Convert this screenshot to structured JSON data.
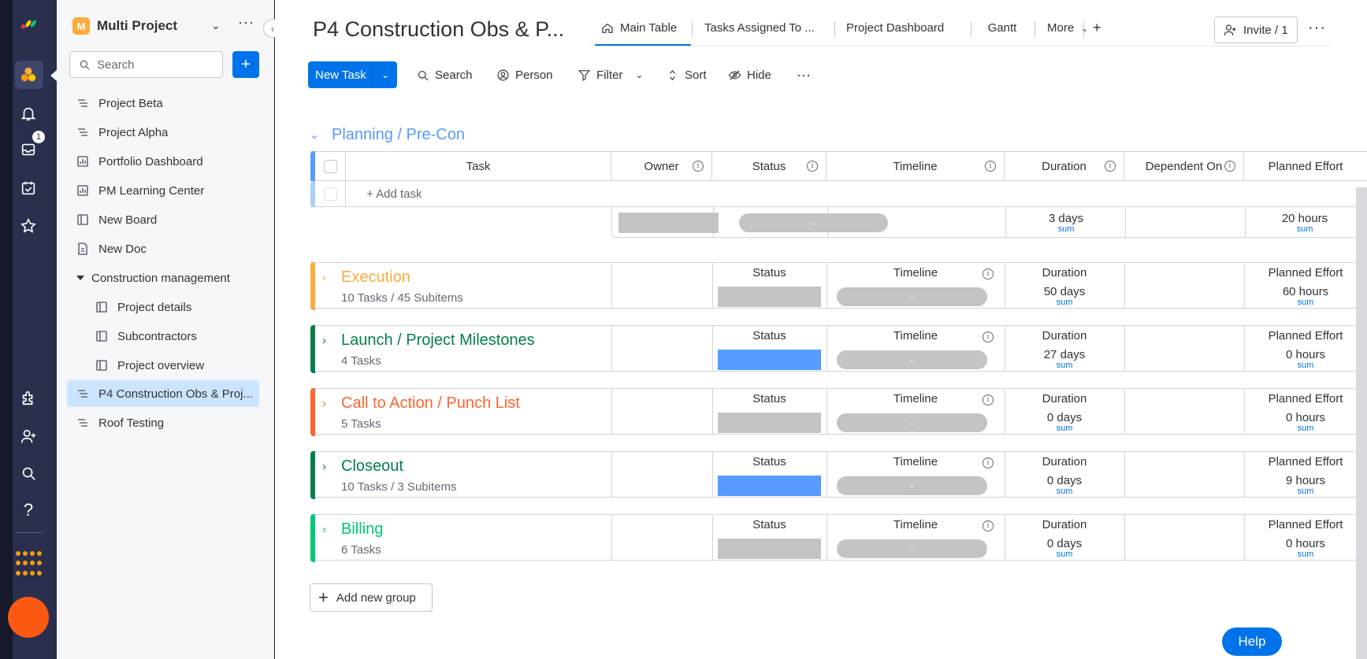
{
  "rail": {
    "notification_count": "1",
    "colors": {
      "bg": "#292f4c",
      "active": "#40466a",
      "apps": "#f59b12",
      "avatar": "#fc5a12"
    }
  },
  "sidebar": {
    "workspace_initial": "M",
    "workspace_name": "Multi Project",
    "search_placeholder": "Search",
    "add_label": "+",
    "items": [
      {
        "label": "Project Beta",
        "icon": "board-icon"
      },
      {
        "label": "Project Alpha",
        "icon": "board-icon"
      },
      {
        "label": "Portfolio Dashboard",
        "icon": "dashboard-icon"
      },
      {
        "label": "PM Learning Center",
        "icon": "dashboard-icon"
      },
      {
        "label": "New Board",
        "icon": "table-icon"
      },
      {
        "label": "New Doc",
        "icon": "doc-icon"
      }
    ],
    "folder": {
      "label": "Construction management",
      "items": [
        {
          "label": "Project details"
        },
        {
          "label": "Subcontractors"
        },
        {
          "label": "Project overview"
        }
      ]
    },
    "selected_item": "P4 Construction Obs & Proj...",
    "last_item": "Roof Testing"
  },
  "header": {
    "title": "P4 Construction Obs & P...",
    "tabs": [
      {
        "label": "Main Table",
        "active": true
      },
      {
        "label": "Tasks Assigned To ..."
      },
      {
        "label": "Project Dashboard"
      },
      {
        "label": "Gantt"
      },
      {
        "label": "More"
      },
      {
        "label": "+"
      }
    ],
    "invite_label": "Invite / 1"
  },
  "toolbar": {
    "new_task": "New Task",
    "search": "Search",
    "person": "Person",
    "filter": "Filter",
    "sort": "Sort",
    "hide": "Hide"
  },
  "expanded_group": {
    "title": "Planning / Pre-Con",
    "color": "#579bfc",
    "columns": {
      "task": "Task",
      "owner": "Owner",
      "status": "Status",
      "timeline": "Timeline",
      "duration": "Duration",
      "dependent_on": "Dependent On",
      "planned_effort": "Planned Effort"
    },
    "add_task": "+ Add task",
    "summary": {
      "timeline": "-",
      "duration": "3 days",
      "duration_label": "sum",
      "effort": "20 hours",
      "effort_label": "sum"
    }
  },
  "groups": [
    {
      "title": "Execution",
      "subtitle": "10 Tasks / 45 Subitems",
      "color": "#fdab3d",
      "status_col": "Status",
      "timeline_col": "Timeline",
      "duration_col": "Duration",
      "effort_col": "Planned Effort",
      "status_fill": "grey",
      "timeline": "-",
      "duration": "50 days",
      "duration_label": "sum",
      "effort": "60 hours",
      "effort_label": "sum"
    },
    {
      "title": "Launch / Project Milestones",
      "subtitle": "4 Tasks",
      "color": "#037f4c",
      "status_col": "Status",
      "timeline_col": "Timeline",
      "duration_col": "Duration",
      "effort_col": "Planned Effort",
      "status_fill": "blue",
      "timeline": "-",
      "duration": "27 days",
      "duration_label": "sum",
      "effort": "0 hours",
      "effort_label": "sum"
    },
    {
      "title": "Call to Action / Punch List",
      "subtitle": "5 Tasks",
      "color": "#ff642e",
      "status_col": "Status",
      "timeline_col": "Timeline",
      "duration_col": "Duration",
      "effort_col": "Planned Effort",
      "status_fill": "grey",
      "timeline": "-",
      "duration": "0 days",
      "duration_label": "sum",
      "effort": "0 hours",
      "effort_label": "sum"
    },
    {
      "title": "Closeout",
      "subtitle": "10 Tasks / 3 Subitems",
      "color": "#037f4c",
      "status_col": "Status",
      "timeline_col": "Timeline",
      "duration_col": "Duration",
      "effort_col": "Planned Effort",
      "status_fill": "blue",
      "timeline": "-",
      "duration": "0 days",
      "duration_label": "sum",
      "effort": "9 hours",
      "effort_label": "sum"
    },
    {
      "title": "Billing",
      "subtitle": "6 Tasks",
      "color": "#00c875",
      "status_col": "Status",
      "timeline_col": "Timeline",
      "duration_col": "Duration",
      "effort_col": "Planned Effort",
      "status_fill": "grey",
      "timeline": "-",
      "duration": "0 days",
      "duration_label": "sum",
      "effort": "0 hours",
      "effort_label": "sum"
    }
  ],
  "footer": {
    "add_group": "Add new group",
    "help": "Help"
  }
}
